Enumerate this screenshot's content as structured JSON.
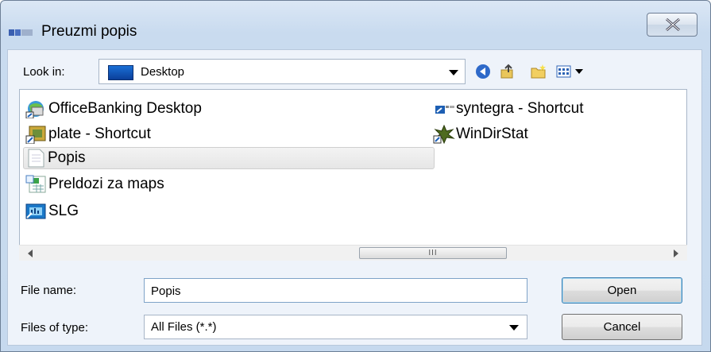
{
  "window": {
    "title": "Preuzmi popis"
  },
  "look_in": {
    "label": "Look in:",
    "value": "Desktop"
  },
  "toolbar": {
    "icons": [
      "back-icon",
      "up-folder-icon",
      "new-folder-icon",
      "view-menu-icon"
    ]
  },
  "files": [
    {
      "name": "OfficeBanking Desktop",
      "icon": "officebanking-icon"
    },
    {
      "name": "plate - Shortcut",
      "icon": "plate-shortcut-icon"
    },
    {
      "name": "Popis",
      "icon": "text-file-icon",
      "selected": true
    },
    {
      "name": "Preldozi za maps",
      "icon": "spreadsheet-icon"
    },
    {
      "name": "SLG",
      "icon": "slg-icon"
    },
    {
      "name": "syntegra - Shortcut",
      "icon": "syntegra-shortcut-icon"
    },
    {
      "name": "WinDirStat",
      "icon": "windirstat-icon"
    }
  ],
  "scrollbar": {
    "grip": "III"
  },
  "file_name": {
    "label": "File name:",
    "value": "Popis"
  },
  "file_type": {
    "label": "Files of type:",
    "value": "All Files (*.*)"
  },
  "buttons": {
    "open": "Open",
    "cancel": "Cancel"
  }
}
